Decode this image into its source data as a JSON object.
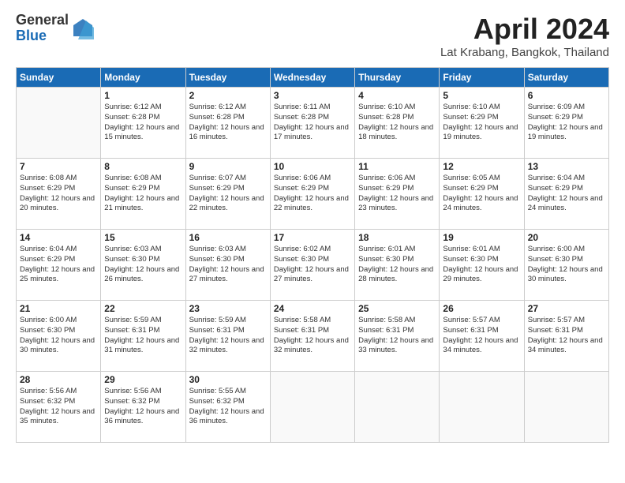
{
  "logo": {
    "general": "General",
    "blue": "Blue"
  },
  "title": "April 2024",
  "location": "Lat Krabang, Bangkok, Thailand",
  "headers": [
    "Sunday",
    "Monday",
    "Tuesday",
    "Wednesday",
    "Thursday",
    "Friday",
    "Saturday"
  ],
  "weeks": [
    [
      {
        "day": "",
        "info": ""
      },
      {
        "day": "1",
        "info": "Sunrise: 6:12 AM\nSunset: 6:28 PM\nDaylight: 12 hours and 15 minutes."
      },
      {
        "day": "2",
        "info": "Sunrise: 6:12 AM\nSunset: 6:28 PM\nDaylight: 12 hours and 16 minutes."
      },
      {
        "day": "3",
        "info": "Sunrise: 6:11 AM\nSunset: 6:28 PM\nDaylight: 12 hours and 17 minutes."
      },
      {
        "day": "4",
        "info": "Sunrise: 6:10 AM\nSunset: 6:28 PM\nDaylight: 12 hours and 18 minutes."
      },
      {
        "day": "5",
        "info": "Sunrise: 6:10 AM\nSunset: 6:29 PM\nDaylight: 12 hours and 19 minutes."
      },
      {
        "day": "6",
        "info": "Sunrise: 6:09 AM\nSunset: 6:29 PM\nDaylight: 12 hours and 19 minutes."
      }
    ],
    [
      {
        "day": "7",
        "info": "Sunrise: 6:08 AM\nSunset: 6:29 PM\nDaylight: 12 hours and 20 minutes."
      },
      {
        "day": "8",
        "info": "Sunrise: 6:08 AM\nSunset: 6:29 PM\nDaylight: 12 hours and 21 minutes."
      },
      {
        "day": "9",
        "info": "Sunrise: 6:07 AM\nSunset: 6:29 PM\nDaylight: 12 hours and 22 minutes."
      },
      {
        "day": "10",
        "info": "Sunrise: 6:06 AM\nSunset: 6:29 PM\nDaylight: 12 hours and 22 minutes."
      },
      {
        "day": "11",
        "info": "Sunrise: 6:06 AM\nSunset: 6:29 PM\nDaylight: 12 hours and 23 minutes."
      },
      {
        "day": "12",
        "info": "Sunrise: 6:05 AM\nSunset: 6:29 PM\nDaylight: 12 hours and 24 minutes."
      },
      {
        "day": "13",
        "info": "Sunrise: 6:04 AM\nSunset: 6:29 PM\nDaylight: 12 hours and 24 minutes."
      }
    ],
    [
      {
        "day": "14",
        "info": "Sunrise: 6:04 AM\nSunset: 6:29 PM\nDaylight: 12 hours and 25 minutes."
      },
      {
        "day": "15",
        "info": "Sunrise: 6:03 AM\nSunset: 6:30 PM\nDaylight: 12 hours and 26 minutes."
      },
      {
        "day": "16",
        "info": "Sunrise: 6:03 AM\nSunset: 6:30 PM\nDaylight: 12 hours and 27 minutes."
      },
      {
        "day": "17",
        "info": "Sunrise: 6:02 AM\nSunset: 6:30 PM\nDaylight: 12 hours and 27 minutes."
      },
      {
        "day": "18",
        "info": "Sunrise: 6:01 AM\nSunset: 6:30 PM\nDaylight: 12 hours and 28 minutes."
      },
      {
        "day": "19",
        "info": "Sunrise: 6:01 AM\nSunset: 6:30 PM\nDaylight: 12 hours and 29 minutes."
      },
      {
        "day": "20",
        "info": "Sunrise: 6:00 AM\nSunset: 6:30 PM\nDaylight: 12 hours and 30 minutes."
      }
    ],
    [
      {
        "day": "21",
        "info": "Sunrise: 6:00 AM\nSunset: 6:30 PM\nDaylight: 12 hours and 30 minutes."
      },
      {
        "day": "22",
        "info": "Sunrise: 5:59 AM\nSunset: 6:31 PM\nDaylight: 12 hours and 31 minutes."
      },
      {
        "day": "23",
        "info": "Sunrise: 5:59 AM\nSunset: 6:31 PM\nDaylight: 12 hours and 32 minutes."
      },
      {
        "day": "24",
        "info": "Sunrise: 5:58 AM\nSunset: 6:31 PM\nDaylight: 12 hours and 32 minutes."
      },
      {
        "day": "25",
        "info": "Sunrise: 5:58 AM\nSunset: 6:31 PM\nDaylight: 12 hours and 33 minutes."
      },
      {
        "day": "26",
        "info": "Sunrise: 5:57 AM\nSunset: 6:31 PM\nDaylight: 12 hours and 34 minutes."
      },
      {
        "day": "27",
        "info": "Sunrise: 5:57 AM\nSunset: 6:31 PM\nDaylight: 12 hours and 34 minutes."
      }
    ],
    [
      {
        "day": "28",
        "info": "Sunrise: 5:56 AM\nSunset: 6:32 PM\nDaylight: 12 hours and 35 minutes."
      },
      {
        "day": "29",
        "info": "Sunrise: 5:56 AM\nSunset: 6:32 PM\nDaylight: 12 hours and 36 minutes."
      },
      {
        "day": "30",
        "info": "Sunrise: 5:55 AM\nSunset: 6:32 PM\nDaylight: 12 hours and 36 minutes."
      },
      {
        "day": "",
        "info": ""
      },
      {
        "day": "",
        "info": ""
      },
      {
        "day": "",
        "info": ""
      },
      {
        "day": "",
        "info": ""
      }
    ]
  ]
}
